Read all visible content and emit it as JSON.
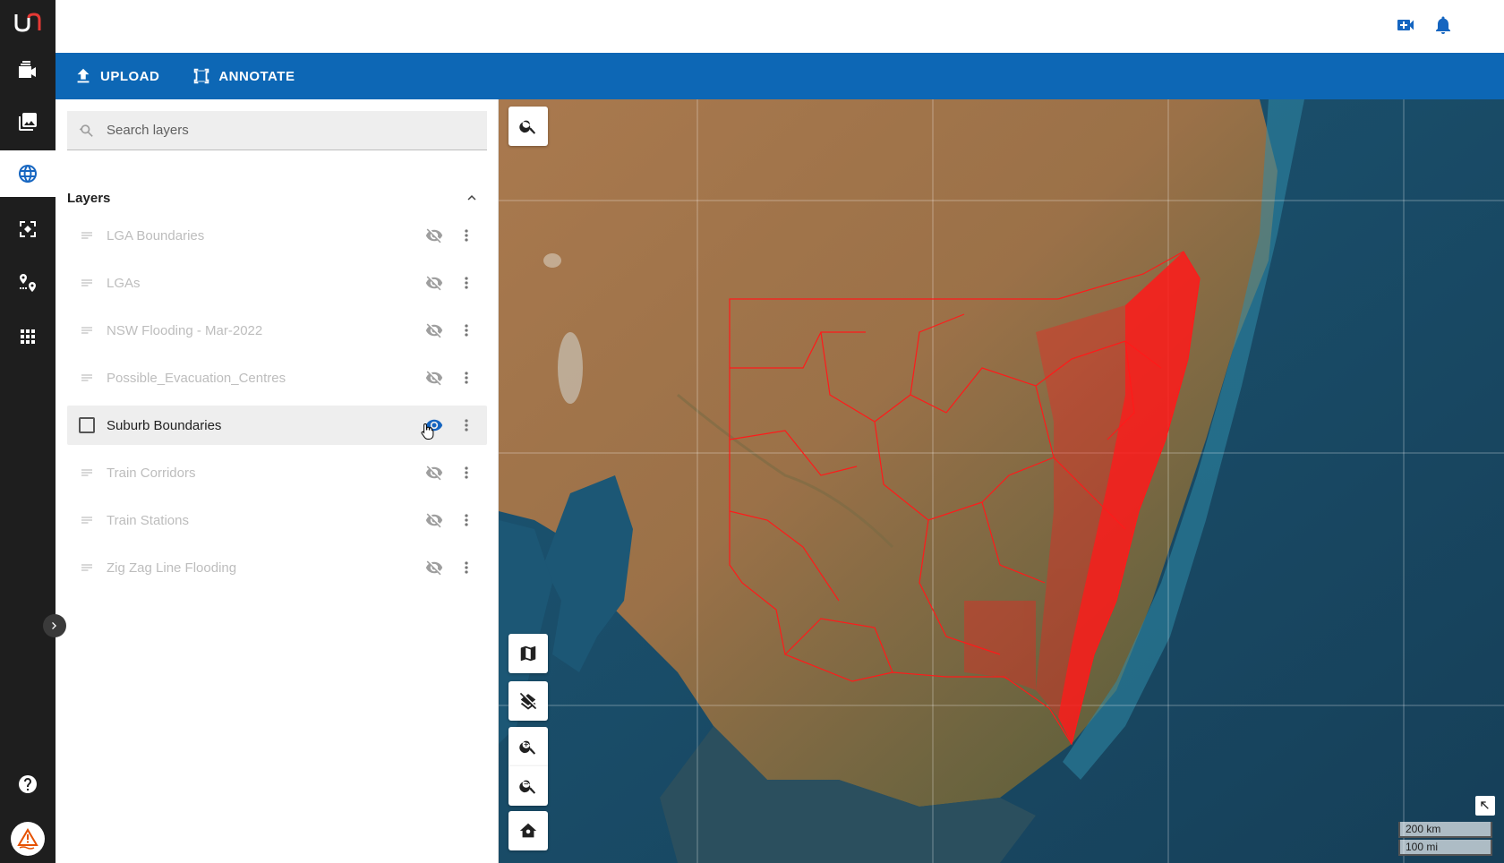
{
  "toolbar": {
    "upload_label": "UPLOAD",
    "annotate_label": "ANNOTATE"
  },
  "rail": {
    "items": [
      {
        "name": "video",
        "icon": "video-stack-icon"
      },
      {
        "name": "gallery",
        "icon": "image-gallery-icon"
      },
      {
        "name": "map",
        "icon": "globe-icon",
        "active": true
      },
      {
        "name": "detect",
        "icon": "focus-icon"
      },
      {
        "name": "route",
        "icon": "route-icon"
      },
      {
        "name": "apps",
        "icon": "apps-grid-icon"
      }
    ]
  },
  "panel": {
    "search_placeholder": "Search layers",
    "layers_title": "Layers",
    "layers": [
      {
        "label": "LGA Boundaries",
        "visible": false,
        "selected": false
      },
      {
        "label": "LGAs",
        "visible": false,
        "selected": false
      },
      {
        "label": "NSW Flooding - Mar-2022",
        "visible": false,
        "selected": false
      },
      {
        "label": "Possible_Evacuation_Centres",
        "visible": false,
        "selected": false
      },
      {
        "label": "Suburb Boundaries",
        "visible": true,
        "selected": true
      },
      {
        "label": "Train Corridors",
        "visible": false,
        "selected": false
      },
      {
        "label": "Train Stations",
        "visible": false,
        "selected": false
      },
      {
        "label": "Zig Zag Line Flooding",
        "visible": false,
        "selected": false
      }
    ]
  },
  "map": {
    "scale_km": "200 km",
    "scale_mi": "100 mi",
    "boundary_color": "#ff1a1a"
  },
  "colors": {
    "accent": "#0d67b5",
    "rail": "#1e1e1e"
  }
}
